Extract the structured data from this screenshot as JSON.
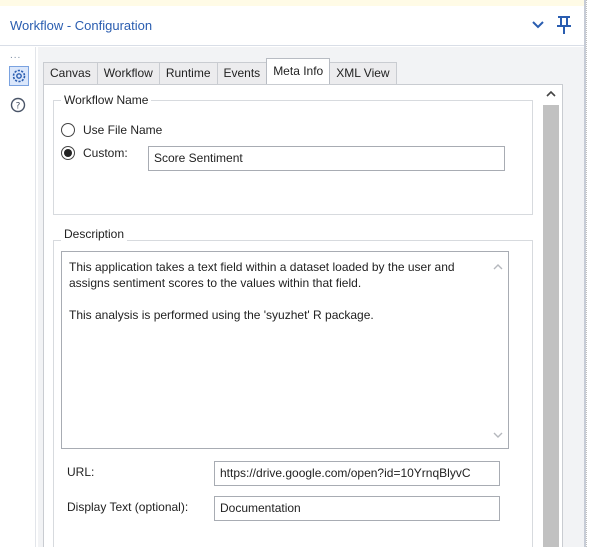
{
  "window": {
    "title": "Workflow - Configuration",
    "collapse_icon": "chevron-down-icon",
    "pin_icon": "pin-icon"
  },
  "rail": {
    "handle": "...",
    "items": [
      {
        "name": "settings",
        "icon": "gear-icon",
        "active": true
      },
      {
        "name": "help",
        "icon": "help-icon",
        "active": false
      }
    ]
  },
  "tabs": [
    {
      "label": "Canvas",
      "active": false
    },
    {
      "label": "Workflow",
      "active": false
    },
    {
      "label": "Runtime",
      "active": false
    },
    {
      "label": "Events",
      "active": false
    },
    {
      "label": "Meta Info",
      "active": true
    },
    {
      "label": "XML View",
      "active": false
    }
  ],
  "workflow_name": {
    "legend": "Workflow Name",
    "use_file_name_label": "Use File Name",
    "custom_label": "Custom:",
    "custom_value": "Score Sentiment",
    "selected": "custom"
  },
  "description": {
    "legend": "Description",
    "paragraph_1": "This application takes a text field within a dataset loaded by the user and assigns sentiment scores to the values within that field.",
    "paragraph_2": "This analysis is performed using the 'syuzhet' R package.",
    "url_label": "URL:",
    "url_value": "https://drive.google.com/open?id=10YrnqBlyvC",
    "display_text_label": "Display Text (optional):",
    "display_text_value": "Documentation"
  },
  "colors": {
    "title": "#2a5db0",
    "accent": "#2a5db0",
    "panel_bg": "#f2f3f5"
  }
}
